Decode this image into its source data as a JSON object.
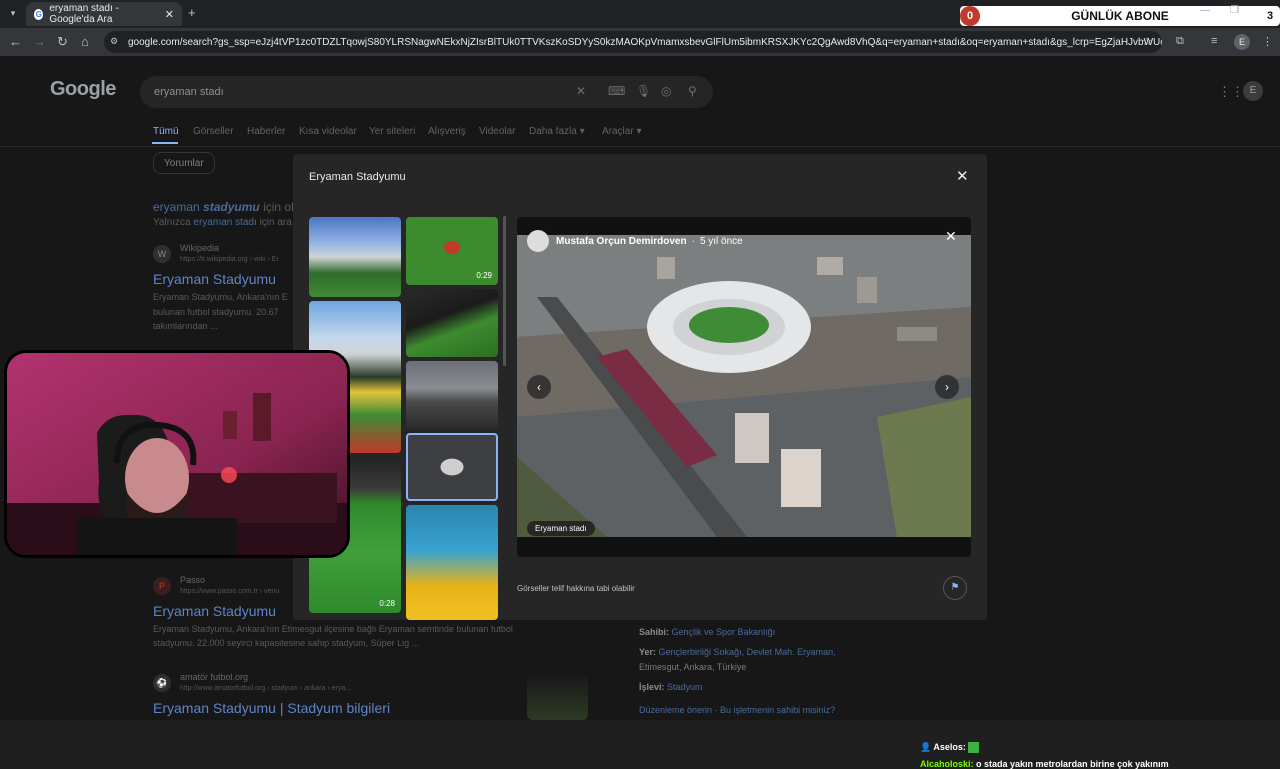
{
  "browser": {
    "tab_title": "eryaman stadı - Google'da Ara",
    "url": "google.com/search?gs_ssp=eJzj4tVP1zc0TDZLTqowjS80YLRSNagwNEkxNjZIsrBlTUk0TTVKszKoSDYyS0kzMAOKpVmamxsbevGlFlUm5ibmKRSXJKYc2QgAwd8VhQ&q=eryaman+stadı&oq=eryaman+stadı&gs_lcrp=EgZjaHJvbWUqDQgBEC4YrwEYx...",
    "profile_initial": "E"
  },
  "overlay": {
    "abone_label": "GÜNLÜK ABONE",
    "abone_left": "0",
    "abone_right": "3"
  },
  "google": {
    "logo": "Google",
    "query": "eryaman stadı",
    "filters": [
      "Tümü",
      "Görseller",
      "Haberler",
      "Kısa videolar",
      "Yer siteleri",
      "Alışveriş",
      "Videolar",
      "Daha fazla",
      "Araçlar"
    ],
    "chip": "Yorumlar",
    "user_initial": "E"
  },
  "results": {
    "correction_prefix": "eryaman",
    "correction_em": "stadyumu",
    "correction_suffix": "için ol",
    "only_prefix": "Yalnızca",
    "only_link": "eryaman stadı",
    "only_suffix": "için ara",
    "r1_site": "Wikipedia",
    "r1_url": "https://tr.wikipedia.org › wiki › Er",
    "r1_title": "Eryaman Stadyumu",
    "r1_snip1": "Eryaman Stadyumu, Ankara'nın E",
    "r1_snip2": "bulunan futbol stadyumu. 20.67",
    "r1_snip3": "takımlarından ...",
    "r2_site": "Passo",
    "r2_url": "https://www.passo.com.tr › venu",
    "r2_title": "Eryaman Stadyumu",
    "r2_snip1": "Eryaman Stadyumu, Ankara'nın Etimesgut ilçesine bağlı Eryaman semtinde bulunan futbol",
    "r2_snip2": "stadyumu. 22.000 seyirci kapasitesine sahip stadyum, Süper Lig ...",
    "r3_site": "amatör futbol.org",
    "r3_url": "http://www.amatorfutbol.org › stadyum › ankara › erya...",
    "r3_title": "Eryaman Stadyumu | Stadyum bilgileri"
  },
  "modal": {
    "title": "Eryaman Stadyumu",
    "author": "Mustafa Orçun Demirdoven",
    "age": "5 yıl önce",
    "caption": "Eryaman stadı",
    "copyright": "Görseller telif hakkına tabi olabilir",
    "durations": [
      "0:29",
      "0:28"
    ]
  },
  "knowledge_panel": {
    "owner_label": "Sahibi:",
    "owner_value": "Gençlik ve Spor Bakanlığı",
    "place_label": "Yer:",
    "place_value1": "Gençlerbirliği Sokağı, Devlet Mah. Eryaman,",
    "place_value2": "Etimesgut, Ankara, Türkiye",
    "func_label": "İşlevi:",
    "func_value": "Stadyum",
    "edit_link": "Düzenleme önerin",
    "owner_link": "Bu işletmenin sahibi misiniz?"
  },
  "chat": {
    "m1_user": "Aselos:",
    "m2_user": "Alcaholoski:",
    "m2_text": "o stada yakın metrolardan birine çok yakınım"
  }
}
